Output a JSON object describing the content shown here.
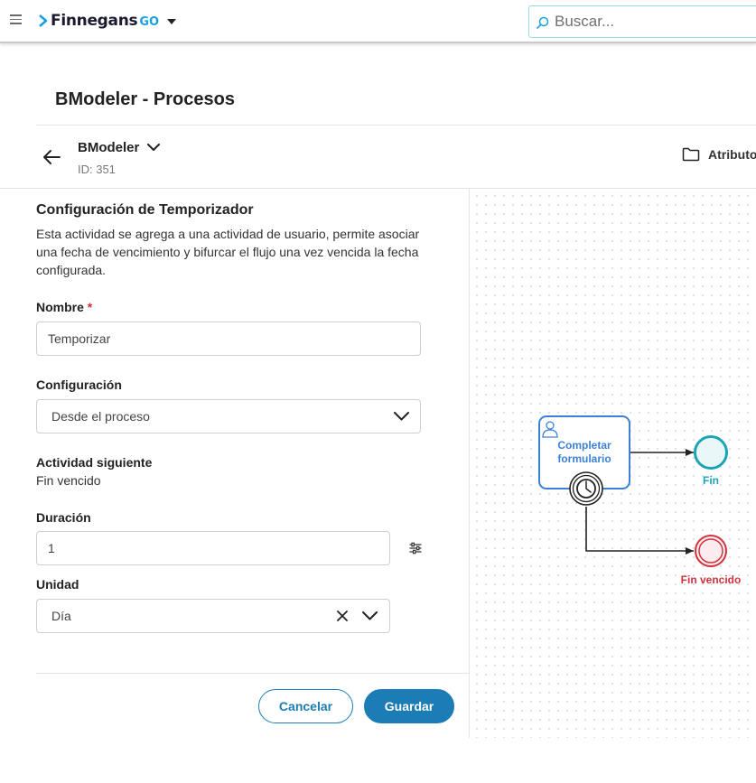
{
  "header": {
    "logo_text": "Finnegans",
    "logo_suffix": "GO",
    "search_placeholder": "Buscar..."
  },
  "page": {
    "title": "BModeler - Procesos"
  },
  "process": {
    "name": "BModeler",
    "id_label": "ID: 351",
    "attributes_label": "Atributos"
  },
  "form": {
    "title": "Configuración de Temporizador",
    "description": "Esta actividad se agrega a una actividad de usuario, permite asociar una fecha de vencimiento y bifurcar el flujo una vez vencida la fecha configurada.",
    "name_label": "Nombre",
    "name_required_mark": "*",
    "name_value": "Temporizar",
    "config_label": "Configuración",
    "config_value": "Desde el proceso",
    "next_activity_label": "Actividad siguiente",
    "next_activity_value": "Fin vencido",
    "duration_label": "Duración",
    "duration_value": "1",
    "unit_label": "Unidad",
    "unit_value": "Día",
    "cancel_label": "Cancelar",
    "save_label": "Guardar"
  },
  "diagram": {
    "task_label_line1": "Completar",
    "task_label_line2": "formulario",
    "end_label": "Fin",
    "end_expired_label": "Fin vencido"
  },
  "colors": {
    "primary": "#1b7cb6",
    "task_border": "#3b82d6",
    "end_event": "#1aa4b5",
    "end_expired": "#d0323e",
    "required": "#d0323e"
  }
}
